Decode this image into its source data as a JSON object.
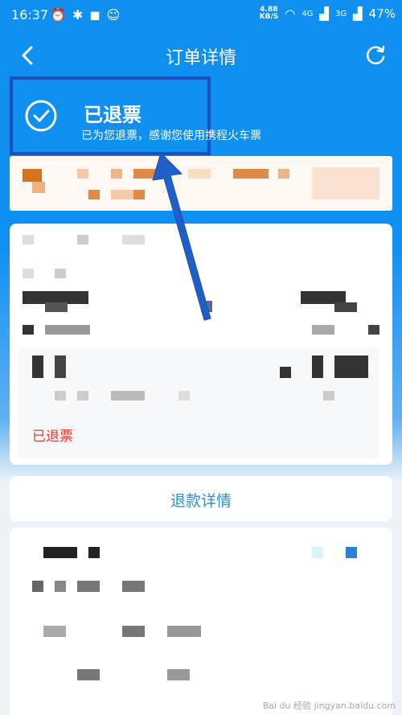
{
  "status_bar": {
    "time": "16:37",
    "network_speed_value": "4.88",
    "network_speed_unit": "KB/S",
    "signal_1": "4G",
    "signal_2": "3G",
    "battery": "47%"
  },
  "navbar": {
    "title": "订单详情",
    "back_icon": "chevron-left-icon",
    "refresh_icon": "refresh-icon"
  },
  "order_status": {
    "title": "已退票",
    "subtitle": "已为您退票，感谢您使用携程火车票"
  },
  "ticket": {
    "status_label": "已退票"
  },
  "refund_details_button": "退款详情",
  "watermark": "Bai du 经验 jingyan.baidu.com",
  "colors": {
    "header_blue": "#0f8ff0",
    "highlight_border": "#1d4fb8",
    "refund_red": "#e03c31",
    "link_blue": "#2b8fd6"
  }
}
